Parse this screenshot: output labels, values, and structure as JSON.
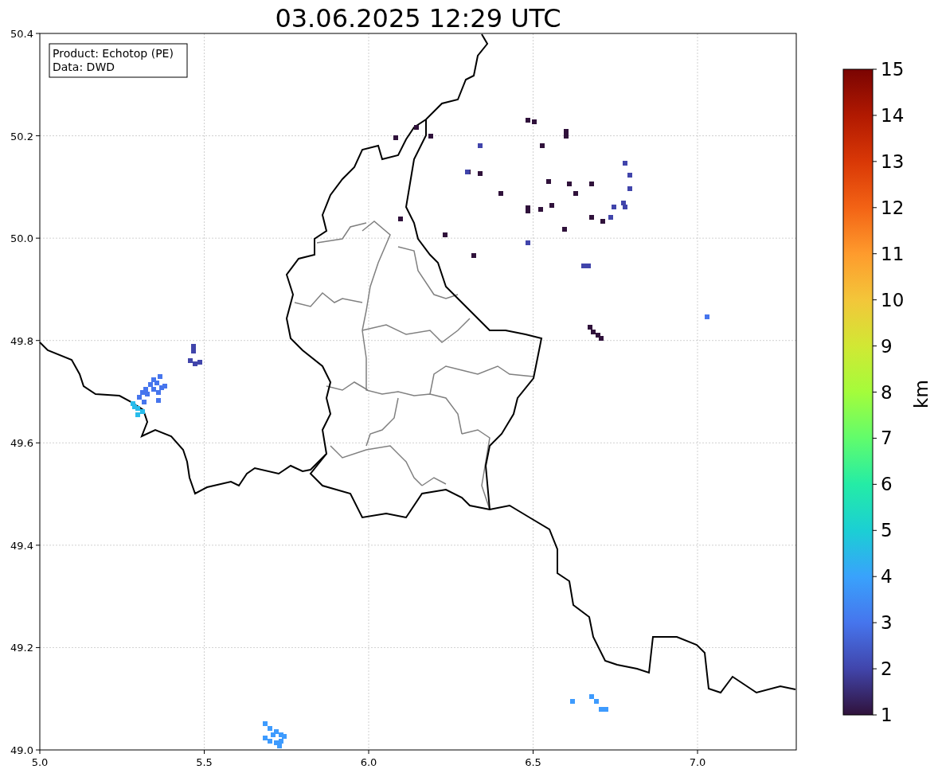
{
  "title": "03.06.2025 12:29 UTC",
  "annotation": {
    "lines": [
      "Product: Echotop (PE)",
      "Data: DWD"
    ]
  },
  "map": {
    "xticks": [
      "5.0",
      "5.5",
      "6.0",
      "6.5",
      "7.0"
    ],
    "yticks": [
      "50.4",
      "50.2",
      "50.0",
      "49.8",
      "49.6",
      "49.4",
      "49.2",
      "49.0"
    ]
  },
  "colorbar": {
    "ticks": [
      "15",
      "14",
      "13",
      "12",
      "11",
      "10",
      "9",
      "8",
      "7",
      "6",
      "5",
      "4",
      "3",
      "2",
      "1"
    ],
    "label": "km"
  }
}
